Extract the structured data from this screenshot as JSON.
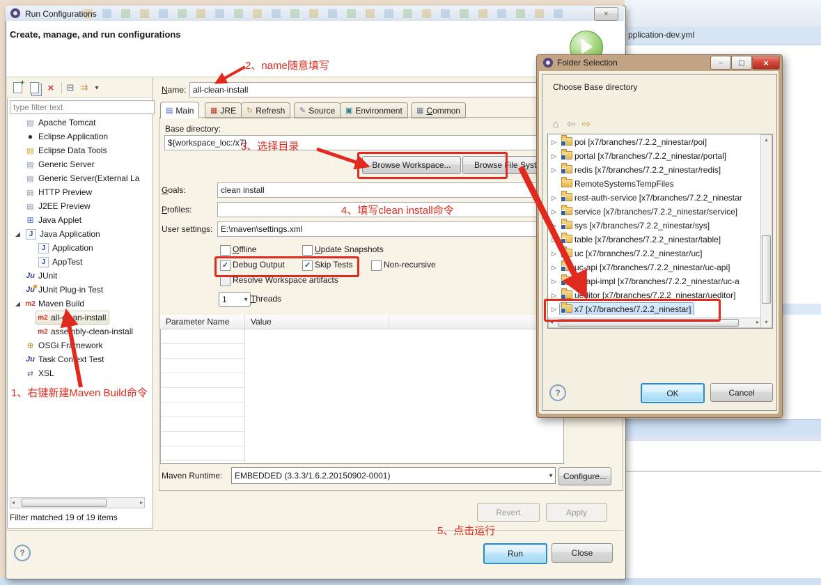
{
  "annotations": {
    "step1": "1、右键新建Maven Build命令",
    "step2": "2、name随意填写",
    "step3": "3、选择目录",
    "step4": "4、填写clean install命令",
    "step5": "5、点击运行"
  },
  "background": {
    "editor_tab": "pplication-dev.yml"
  },
  "run_dialog": {
    "title": "Run Configurations",
    "close_glyph": "×",
    "header": "Create, manage, and run configurations",
    "toolbar": {
      "new_plus": "+",
      "delete": "×",
      "collapse": "⊟",
      "filter": "⇉",
      "caret": "▾"
    },
    "filter_hint": "type filter text",
    "tree_items": [
      {
        "label": "Apache Tomcat",
        "kind": "server",
        "icon": "▤",
        "expander": ""
      },
      {
        "label": "Eclipse Application",
        "kind": "eclipse",
        "icon": "●",
        "expander": ""
      },
      {
        "label": "Eclipse Data Tools",
        "kind": "db",
        "icon": "▤",
        "expander": ""
      },
      {
        "label": "Generic Server",
        "kind": "server",
        "icon": "▤",
        "expander": ""
      },
      {
        "label": "Generic Server(External La",
        "kind": "server",
        "icon": "▤",
        "expander": ""
      },
      {
        "label": "HTTP Preview",
        "kind": "server",
        "icon": "▤",
        "expander": ""
      },
      {
        "label": "J2EE Preview",
        "kind": "server",
        "icon": "▤",
        "expander": ""
      },
      {
        "label": "Java Applet",
        "kind": "applet",
        "icon": "⊞",
        "expander": ""
      },
      {
        "label": "Java Application",
        "kind": "java",
        "icon": "J",
        "expander": "◢"
      },
      {
        "label": "Application",
        "kind": "java",
        "icon": "J",
        "expander": "",
        "indent": true
      },
      {
        "label": "AppTest",
        "kind": "java",
        "icon": "J",
        "expander": "",
        "indent": true
      },
      {
        "label": "JUnit",
        "kind": "junit",
        "icon": "Ju",
        "expander": ""
      },
      {
        "label": "JUnit Plug-in Test",
        "kind": "junitp",
        "icon": "Ju",
        "expander": ""
      },
      {
        "label": "Maven Build",
        "kind": "m2",
        "icon": "m2",
        "expander": "◢"
      },
      {
        "label": "all-clean-install",
        "kind": "m2",
        "icon": "m2",
        "expander": "",
        "indent": true,
        "selected": true
      },
      {
        "label": "assembly-clean-install",
        "kind": "m2",
        "icon": "m2",
        "expander": "",
        "indent": true
      },
      {
        "label": "OSGi Framework",
        "kind": "osgi",
        "icon": "⊕",
        "expander": ""
      },
      {
        "label": "Task Context Test",
        "kind": "task",
        "icon": "Ju",
        "expander": ""
      },
      {
        "label": "XSL",
        "kind": "xsl",
        "icon": "⇄",
        "expander": ""
      }
    ],
    "filter_status": "Filter matched 19 of 19 items",
    "name_label": "Name:",
    "name_value": "all-clean-install",
    "tabs": [
      {
        "label": "Main",
        "icon": "▤"
      },
      {
        "label": "JRE",
        "icon": "▦"
      },
      {
        "label": "Refresh",
        "icon": "↻"
      },
      {
        "label": "Source",
        "icon": "✎"
      },
      {
        "label": "Environment",
        "icon": "▣"
      },
      {
        "label": "Common",
        "icon": "▦"
      }
    ],
    "main_tab": {
      "base_directory_label": "Base directory:",
      "base_directory_value": "${workspace_loc:/x7}",
      "browse_workspace": "Browse Workspace...",
      "browse_file_system": "Browse File System...",
      "goals_label": "Goals:",
      "goals_value": "clean install",
      "profiles_label": "Profiles:",
      "profiles_value": "",
      "user_settings_label": "User settings:",
      "user_settings_value": "E:\\maven\\settings.xml",
      "checkboxes": [
        {
          "label": "Offline",
          "mark": ""
        },
        {
          "label": "Update Snapshots",
          "mark": ""
        },
        {
          "label": "Debug Output",
          "mark": "✓"
        },
        {
          "label": "Skip Tests",
          "mark": "✓"
        },
        {
          "label": "Non-recursive",
          "mark": ""
        },
        {
          "label": "Resolve Workspace artifacts",
          "mark": ""
        }
      ],
      "threads_value": "1",
      "threads_label": "Threads",
      "table_headers": [
        "Parameter Name",
        "Value"
      ],
      "maven_runtime_label": "Maven Runtime:",
      "maven_runtime_value": "EMBEDDED (3.3.3/1.6.2.20150902-0001)",
      "configure_button": "Configure..."
    },
    "buttons": {
      "revert": "Revert",
      "apply": "Apply",
      "run": "Run",
      "close": "Close"
    },
    "help_glyph": "?"
  },
  "folder_dialog": {
    "title": "Folder Selection",
    "min_glyph": "‒",
    "max_glyph": "▢",
    "close_glyph": "×",
    "prompt": "Choose Base directory",
    "toolbar": {
      "home": "⌂",
      "back": "⇦",
      "forward": "⇨"
    },
    "items": [
      {
        "label": "poi [x7/branches/7.2.2_ninestar/poi]",
        "kind": "mfolder",
        "expander": "▷"
      },
      {
        "label": "portal [x7/branches/7.2.2_ninestar/portal]",
        "kind": "mfolder",
        "expander": "▷"
      },
      {
        "label": "redis [x7/branches/7.2.2_ninestar/redis]",
        "kind": "mfolder",
        "expander": "▷"
      },
      {
        "label": "RemoteSystemsTempFiles",
        "kind": "folder",
        "expander": ""
      },
      {
        "label": "rest-auth-service [x7/branches/7.2.2_ninestar",
        "kind": "mfolder",
        "expander": "▷"
      },
      {
        "label": "service [x7/branches/7.2.2_ninestar/service]",
        "kind": "mfolder",
        "expander": "▷"
      },
      {
        "label": "sys [x7/branches/7.2.2_ninestar/sys]",
        "kind": "mfolder",
        "expander": "▷"
      },
      {
        "label": "table [x7/branches/7.2.2_ninestar/table]",
        "kind": "mfolder",
        "expander": "▷"
      },
      {
        "label": "uc [x7/branches/7.2.2_ninestar/uc]",
        "kind": "mfolder",
        "expander": "▷"
      },
      {
        "label": "uc-api [x7/branches/7.2.2_ninestar/uc-api]",
        "kind": "mfolder",
        "expander": "▷"
      },
      {
        "label": "uc-api-impl [x7/branches/7.2.2_ninestar/uc-a",
        "kind": "mfolder",
        "expander": "▷"
      },
      {
        "label": "ueditor [x7/branches/7.2.2_ninestar/ueditor]",
        "kind": "mfolder",
        "expander": "▷"
      },
      {
        "label": "x7 [x7/branches/7.2.2_ninestar]",
        "kind": "mfolder",
        "expander": "▷",
        "selected": true
      }
    ],
    "ok": "OK",
    "cancel": "Cancel",
    "help_glyph": "?"
  }
}
